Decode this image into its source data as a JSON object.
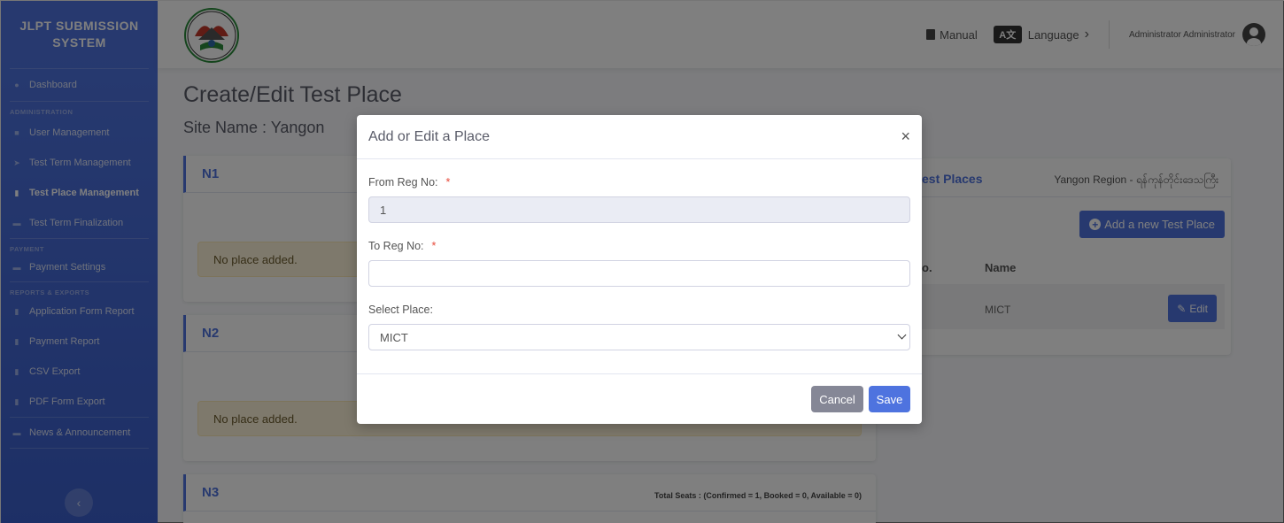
{
  "sidebar": {
    "brand": "JLPT SUBMISSION SYSTEM",
    "dashboard": "Dashboard",
    "heading_admin": "ADMINISTRATION",
    "items_admin": [
      "User Management",
      "Test Term Management",
      "Test Place Management",
      "Test Term Finalization"
    ],
    "heading_payment": "PAYMENT",
    "payment_settings": "Payment Settings",
    "heading_reports": "REPORTS & EXPORTS",
    "items_reports": [
      "Application Form Report",
      "Payment Report",
      "CSV Export",
      "PDF Form Export"
    ],
    "news": "News & Announcement",
    "toggle_icon": "‹"
  },
  "topbar": {
    "manual": "Manual",
    "language_icon": "A文",
    "language": "Language",
    "language_chevron": "›",
    "user": "Administrator Administrator"
  },
  "page": {
    "title": "Create/Edit Test Place",
    "site_name": "Site Name : Yangon"
  },
  "levels": [
    {
      "name": "N1",
      "message": "No place added."
    },
    {
      "name": "N2",
      "message": "No place added."
    },
    {
      "name": "N3",
      "seats": "Total Seats :   (Confirmed = 1, Booked = 0, Available = 0)"
    }
  ],
  "test_places": {
    "title": "est Places",
    "region": "Yangon Region - ရန်ကုန်တိုင်းဒေသကြီး",
    "add_button": "Add a new Test Place",
    "col_no": "o.",
    "col_name": "Name",
    "rows": [
      {
        "name": "MICT",
        "edit": "Edit"
      }
    ]
  },
  "modal": {
    "title": "Add or Edit a Place",
    "close": "×",
    "from_label": "From Reg No:",
    "from_value": "1",
    "to_label": "To Reg No:",
    "to_value": "",
    "required_mark": "*",
    "place_label": "Select Place:",
    "place_value": "MICT",
    "cancel": "Cancel",
    "save": "Save"
  },
  "colors": {
    "primary": "#4e73df",
    "danger": "#e74a3b",
    "secondary": "#858796"
  }
}
